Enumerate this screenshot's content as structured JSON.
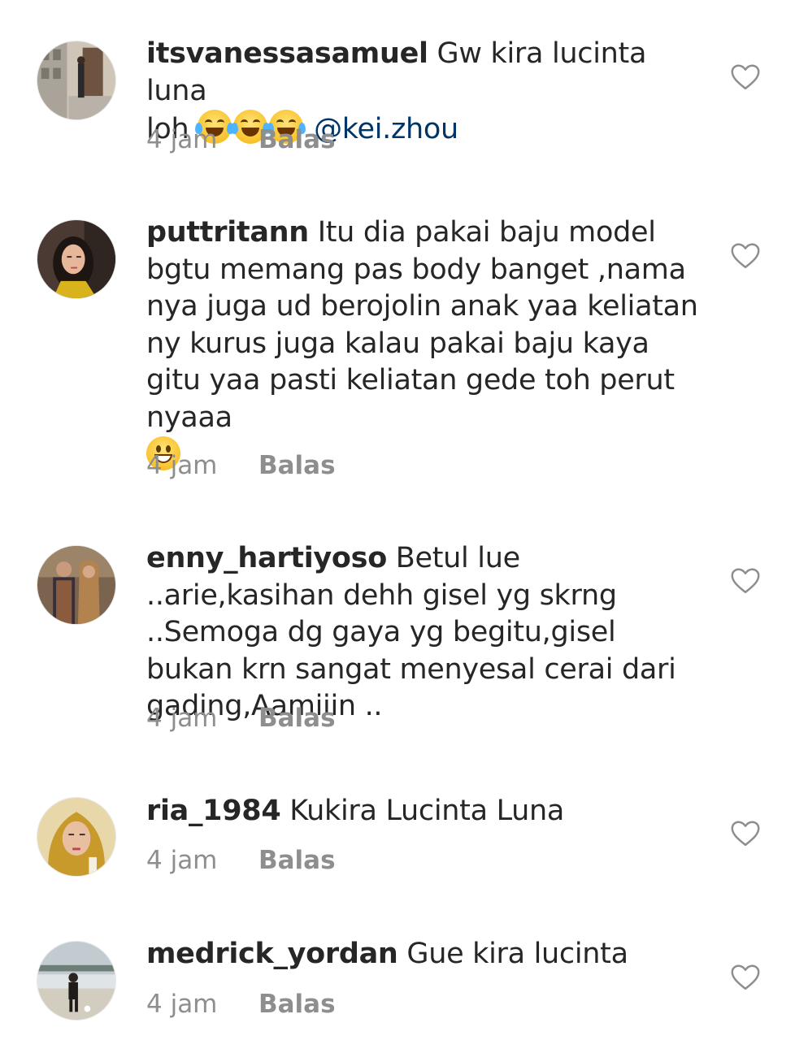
{
  "comments": [
    {
      "username": "itsvanessasamuel",
      "text_before": " Gw kira lucinta luna\nloh ",
      "emojis": [
        "face-with-tears-of-joy",
        "face-with-tears-of-joy",
        "face-with-tears-of-joy"
      ],
      "mention": "@kei.zhou",
      "text_after": "",
      "time": "4 jam",
      "reply": "Balas",
      "avatar": "avatar-street-photo"
    },
    {
      "username": "puttritann",
      "text_before": " Itu dia pakai baju model bgtu memang pas body banget ,nama nya juga ud berojolin anak yaa keliatan ny kurus juga kalau pakai baju kaya gitu yaa pasti keliatan gede toh perut nyaaa\n",
      "emojis": [
        "grinning-face"
      ],
      "mention": "",
      "text_after": "",
      "time": "4 jam",
      "reply": "Balas",
      "avatar": "avatar-woman-selfie"
    },
    {
      "username": "enny_hartiyoso",
      "text_before": " Betul lue ..arie,kasihan dehh gisel yg skrng ..Semoga dg gaya yg begitu,gisel bukan krn sangat menyesal cerai dari gading,Aamiiin ..",
      "emojis": [],
      "mention": "",
      "text_after": "",
      "time": "4 jam",
      "reply": "Balas",
      "avatar": "avatar-couple-photo"
    },
    {
      "username": "ria_1984",
      "text_before": " Kukira Lucinta Luna",
      "emojis": [],
      "mention": "",
      "text_after": "",
      "time": "4 jam",
      "reply": "Balas",
      "avatar": "avatar-woman-hijab"
    },
    {
      "username": "medrick_yordan",
      "text_before": " Gue kira lucinta",
      "emojis": [],
      "mention": "",
      "text_after": "",
      "time": "4 jam",
      "reply": "Balas",
      "avatar": "avatar-beach-photo"
    }
  ],
  "icons": {
    "like": "heart-outline-icon"
  },
  "colors": {
    "text": "#262626",
    "secondary": "#8e8e8e",
    "mention": "#003569"
  }
}
